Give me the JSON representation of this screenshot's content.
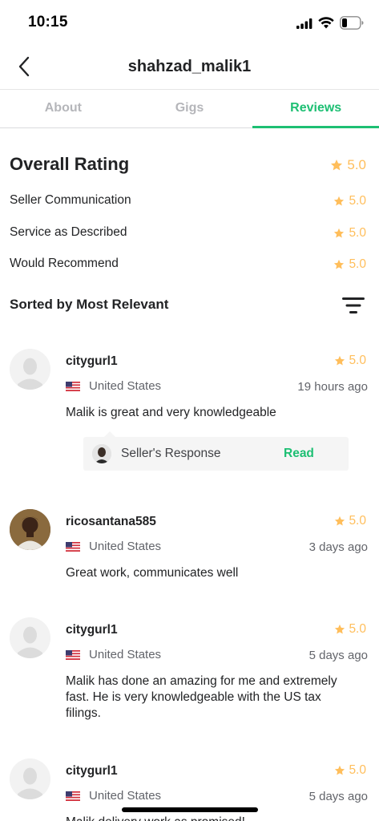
{
  "status_bar": {
    "time": "10:15"
  },
  "header": {
    "title": "shahzad_malik1"
  },
  "tabs": [
    {
      "label": "About",
      "active": false
    },
    {
      "label": "Gigs",
      "active": false
    },
    {
      "label": "Reviews",
      "active": true
    }
  ],
  "ratings": {
    "overall": {
      "label": "Overall Rating",
      "value": "5.0"
    },
    "items": [
      {
        "label": "Seller Communication",
        "value": "5.0"
      },
      {
        "label": "Service as Described",
        "value": "5.0"
      },
      {
        "label": "Would Recommend",
        "value": "5.0"
      }
    ]
  },
  "sort": {
    "label": "Sorted by Most Relevant"
  },
  "reviews": [
    {
      "username": "citygurl1",
      "rating": "5.0",
      "country": "United States",
      "time": "19 hours ago",
      "text": "Malik is great and very knowledgeable",
      "seller_response": {
        "label": "Seller's Response",
        "action": "Read"
      }
    },
    {
      "username": "ricosantana585",
      "rating": "5.0",
      "country": "United States",
      "time": "3 days ago",
      "text": "Great work, communicates well"
    },
    {
      "username": "citygurl1",
      "rating": "5.0",
      "country": "United States",
      "time": "5 days ago",
      "text": "Malik has done an amazing for me and extremely fast.  He is very knowledgeable with the US tax filings."
    },
    {
      "username": "citygurl1",
      "rating": "5.0",
      "country": "United States",
      "time": "5 days ago",
      "text": "Malik delivery work as promised!"
    }
  ],
  "colors": {
    "accent": "#1dbf73",
    "star": "#ffbe5b",
    "muted_text": "#62646a",
    "tab_inactive": "#b5b6ba"
  },
  "icons": {
    "back": "chevron-left-icon",
    "star": "star-icon",
    "filter": "filter-lines-icon",
    "flag": "us-flag-icon",
    "avatar_placeholder": "person-silhouette-icon"
  }
}
